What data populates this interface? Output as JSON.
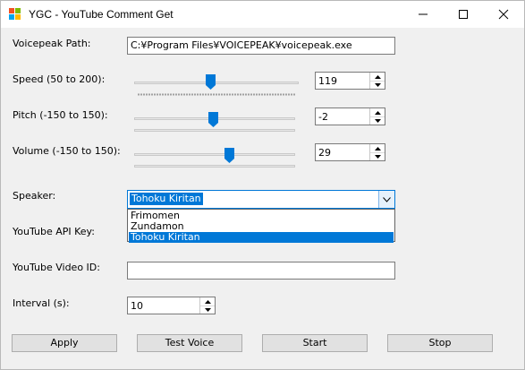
{
  "window": {
    "title": "YGC - YouTube Comment Get"
  },
  "labels": {
    "voicepeak_path": "Voicepeak Path:",
    "speed": "Speed (50 to 200):",
    "pitch": "Pitch (-150 to 150):",
    "volume": "Volume (-150 to 150):",
    "speaker": "Speaker:",
    "youtube_api_key": "YouTube API Key:",
    "youtube_video_id": "YouTube Video ID:",
    "interval": "Interval (s):"
  },
  "fields": {
    "voicepeak_path": "C:¥Program Files¥VOICEPEAK¥voicepeak.exe",
    "youtube_api_key": "",
    "youtube_video_id": "",
    "interval": "10"
  },
  "sliders": {
    "speed": {
      "min": 50,
      "max": 200,
      "value": 119,
      "display": "119"
    },
    "pitch": {
      "min": -150,
      "max": 150,
      "value": -2,
      "display": "-2"
    },
    "volume": {
      "min": -150,
      "max": 150,
      "value": 29,
      "display": "29"
    }
  },
  "speaker": {
    "selected": "Tohoku Kiritan",
    "options": [
      "Frimomen",
      "Zundamon",
      "Tohoku Kiritan"
    ],
    "selected_index": 2
  },
  "buttons": {
    "apply": "Apply",
    "test_voice": "Test Voice",
    "start": "Start",
    "stop": "Stop"
  },
  "colors": {
    "accent": "#0078d7",
    "thumb": "#0078d7",
    "window_bg": "#f0f0f0"
  }
}
